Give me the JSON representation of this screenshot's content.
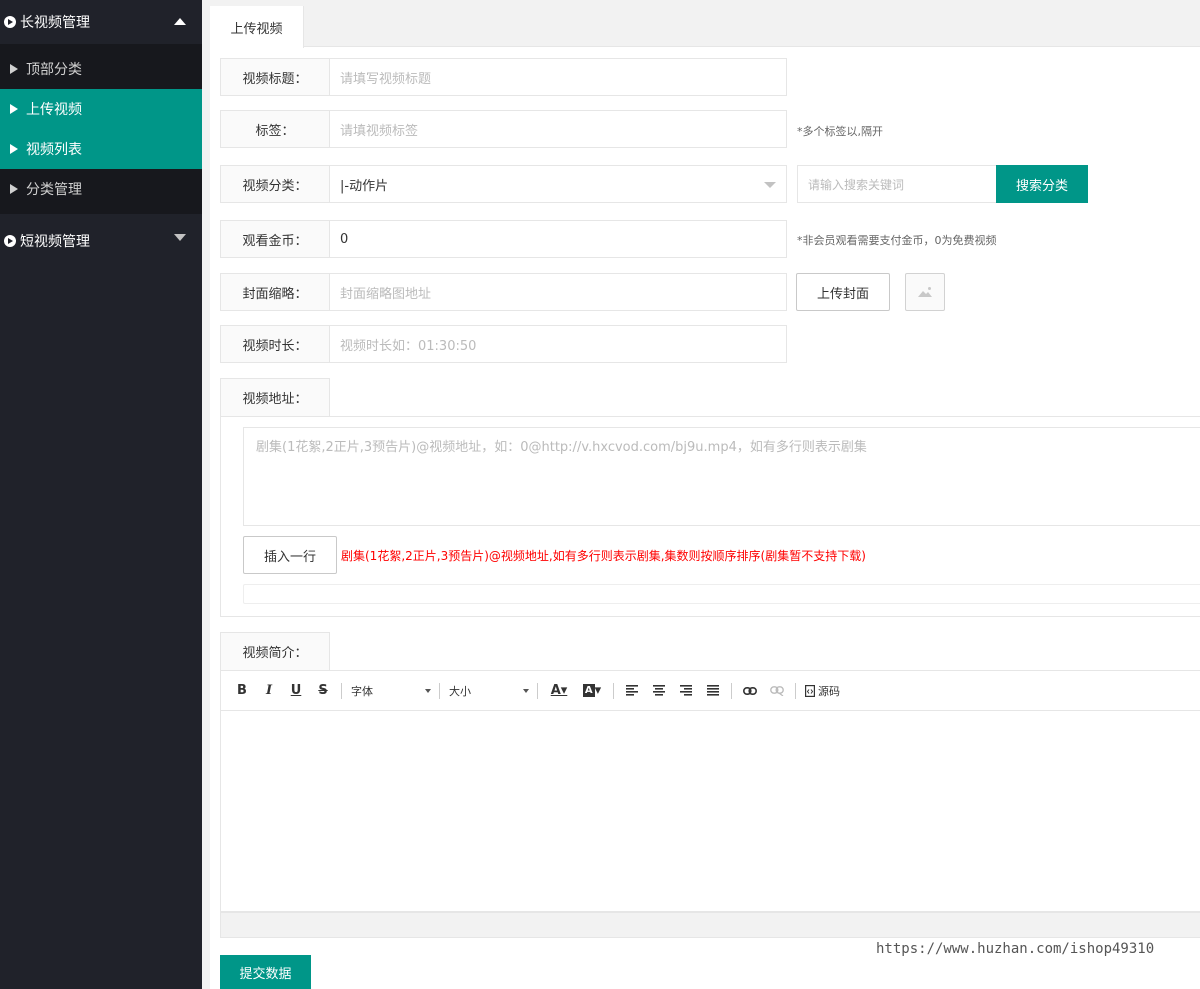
{
  "sidebar": {
    "groups": [
      {
        "title": "长视频管理",
        "expanded": true,
        "items": [
          {
            "label": "顶部分类",
            "active": false
          },
          {
            "label": "上传视频",
            "active": true
          },
          {
            "label": "视频列表",
            "active": true
          },
          {
            "label": "分类管理",
            "active": false
          }
        ]
      },
      {
        "title": "短视频管理",
        "expanded": false,
        "items": []
      }
    ]
  },
  "tabs": [
    {
      "label": "上传视频"
    }
  ],
  "form": {
    "title": {
      "label": "视频标题：",
      "placeholder": "请填写视频标题"
    },
    "tags": {
      "label": "标签：",
      "placeholder": "请填视频标签",
      "hint": "*多个标签以,隔开"
    },
    "category": {
      "label": "视频分类：",
      "value": "|-动作片",
      "search_placeholder": "请输入搜索关键词",
      "search_button": "搜索分类"
    },
    "coins": {
      "label": "观看金币：",
      "value": "0",
      "hint": "*非会员观看需要支付金币，0为免费视频"
    },
    "cover": {
      "label": "封面缩略：",
      "placeholder": "封面缩略图地址",
      "upload_button": "上传封面"
    },
    "duration": {
      "label": "视频时长：",
      "placeholder": "视频时长如：01:30:50"
    },
    "video_url": {
      "label": "视频地址：",
      "placeholder": "剧集(1花絮,2正片,3预告片)@视频地址，如：0@http://v.hxcvod.com/bj9u.mp4，如有多行则表示剧集",
      "insert_button": "插入一行",
      "note": "剧集(1花絮,2正片,3预告片)@视频地址,如有多行则表示剧集,集数则按顺序排序(剧集暂不支持下载)"
    },
    "intro": {
      "label": "视频简介：",
      "toolbar": {
        "font": "字体",
        "size": "大小",
        "source": "源码"
      }
    },
    "submit_button": "提交数据"
  },
  "watermark": "https://www.huzhan.com/ishop49310",
  "colors": {
    "accent": "#009688",
    "sidebar_bg": "#20222a",
    "note_red": "#ff0000"
  }
}
